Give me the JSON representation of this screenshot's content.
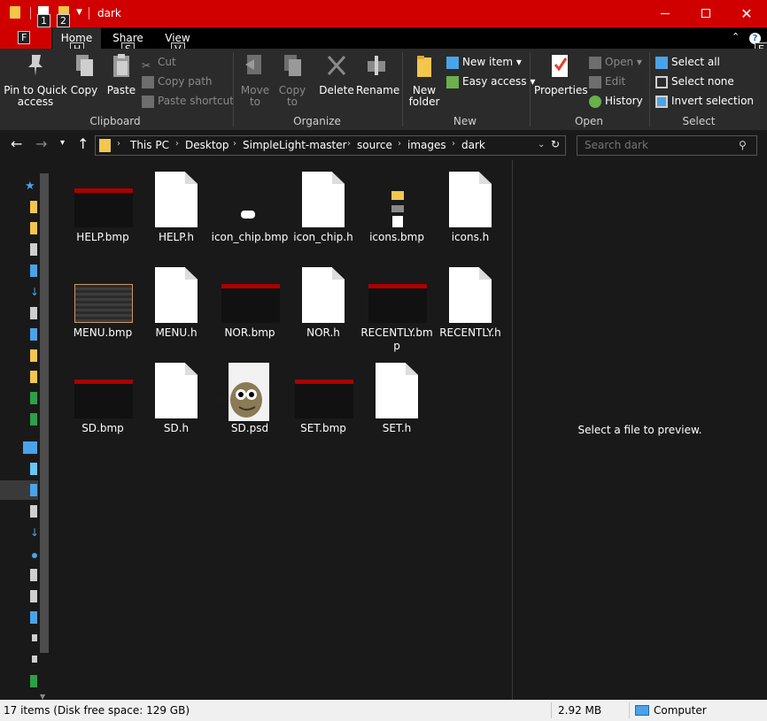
{
  "window": {
    "title": "dark"
  },
  "keytips": {
    "file": "F",
    "qa1": "1",
    "qa2": "2",
    "home": "H",
    "share": "S",
    "view": "V",
    "help": "E"
  },
  "tabs": {
    "home": "Home",
    "share": "Share",
    "view": "View"
  },
  "ribbon": {
    "clipboard": {
      "label": "Clipboard",
      "pin": "Pin to Quick access",
      "copy": "Copy",
      "paste": "Paste",
      "cut": "Cut",
      "copy_path": "Copy path",
      "paste_shortcut": "Paste shortcut"
    },
    "organize": {
      "label": "Organize",
      "move_to": "Move to",
      "copy_to": "Copy to",
      "delete": "Delete",
      "rename": "Rename"
    },
    "new": {
      "label": "New",
      "new_folder": "New folder",
      "new_item": "New item",
      "easy_access": "Easy access"
    },
    "open": {
      "label": "Open",
      "properties": "Properties",
      "open": "Open",
      "edit": "Edit",
      "history": "History"
    },
    "select": {
      "label": "Select",
      "select_all": "Select all",
      "select_none": "Select none",
      "invert": "Invert selection"
    }
  },
  "address": {
    "crumbs": [
      "This PC",
      "Desktop",
      "SimpleLight-master",
      "source",
      "images",
      "dark"
    ]
  },
  "search": {
    "placeholder": "Search dark"
  },
  "files": [
    {
      "name": "HELP.bmp",
      "kind": "bmp"
    },
    {
      "name": "HELP.h",
      "kind": "doc"
    },
    {
      "name": "icon_chip.bmp",
      "kind": "chip"
    },
    {
      "name": "icon_chip.h",
      "kind": "doc"
    },
    {
      "name": "icons.bmp",
      "kind": "icons"
    },
    {
      "name": "icons.h",
      "kind": "doc"
    },
    {
      "name": "MENU.bmp",
      "kind": "menu"
    },
    {
      "name": "MENU.h",
      "kind": "doc"
    },
    {
      "name": "NOR.bmp",
      "kind": "bmp"
    },
    {
      "name": "NOR.h",
      "kind": "doc"
    },
    {
      "name": "RECENTLY.bmp",
      "kind": "bmp"
    },
    {
      "name": "RECENTLY.h",
      "kind": "doc"
    },
    {
      "name": "SD.bmp",
      "kind": "bmp"
    },
    {
      "name": "SD.h",
      "kind": "doc"
    },
    {
      "name": "SD.psd",
      "kind": "gimp"
    },
    {
      "name": "SET.bmp",
      "kind": "bmp"
    },
    {
      "name": "SET.h",
      "kind": "doc"
    }
  ],
  "preview": {
    "message": "Select a file to preview."
  },
  "status": {
    "items": "17 items (Disk free space: 129 GB)",
    "size": "2.92 MB",
    "location": "Computer"
  },
  "colors": {
    "titlebar": "#d10000",
    "background": "#191919",
    "ribbon": "#2b2b2b",
    "folder": "#f3c64d",
    "accent": "#1a6ee0"
  }
}
